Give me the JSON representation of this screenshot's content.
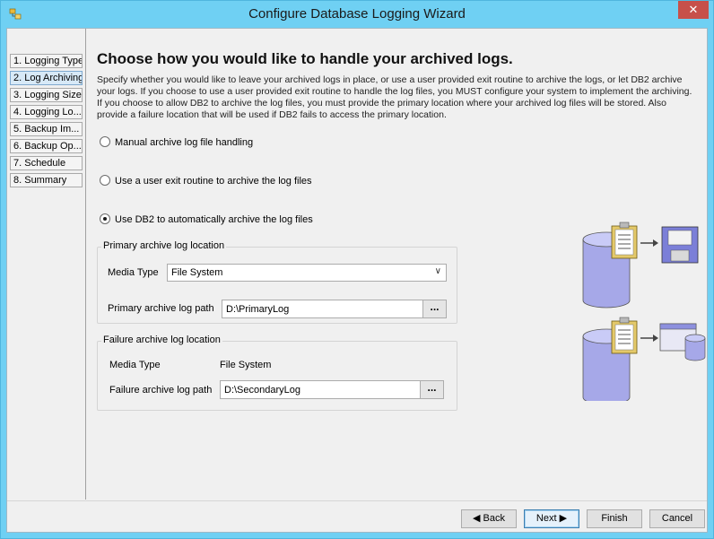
{
  "window": {
    "title": "Configure Database Logging Wizard",
    "close_glyph": "✕"
  },
  "nav": {
    "items": [
      {
        "label": "1. Logging Type"
      },
      {
        "label": "2. Log Archiving"
      },
      {
        "label": "3. Logging Size"
      },
      {
        "label": "4. Logging Lo..."
      },
      {
        "label": "5. Backup Im..."
      },
      {
        "label": "6. Backup Op..."
      },
      {
        "label": "7. Schedule"
      },
      {
        "label": "8. Summary"
      }
    ],
    "active_index": 1
  },
  "page": {
    "heading": "Choose how you would like to handle your archived logs.",
    "description": "Specify whether you would like to leave your archived logs in place, or use a user provided exit routine to archive the logs, or let DB2 archive your logs. If you choose to use a user provided exit routine to handle the log files, you MUST configure your system to implement the archiving. If you choose to allow DB2 to archive the log files, you must provide the primary location where your archived log files will be stored. Also provide a failure location that will be used if DB2 fails to access the primary location.",
    "options": [
      {
        "label": "Manual archive log file handling",
        "checked": false
      },
      {
        "label": "Use a user exit routine to archive the log files",
        "checked": false
      },
      {
        "label": "Use DB2 to automatically archive the log files",
        "checked": true
      }
    ]
  },
  "primary": {
    "group_label": "Primary archive log location",
    "media_type_label": "Media Type",
    "media_type_value": "File System",
    "path_label": "Primary archive log path",
    "path_value": "D:\\PrimaryLog",
    "browse_label": "..."
  },
  "failure": {
    "group_label": "Failure archive log location",
    "media_type_label": "Media Type",
    "media_type_value": "File System",
    "path_label": "Failure archive log path",
    "path_value": "D:\\SecondaryLog",
    "browse_label": "..."
  },
  "icons": {
    "illustration_top": "database-to-floppy-illustration",
    "illustration_bottom": "database-to-server-illustration"
  },
  "buttons": {
    "back": "◀ Back",
    "next": "Next ▶",
    "finish": "Finish",
    "cancel": "Cancel"
  }
}
